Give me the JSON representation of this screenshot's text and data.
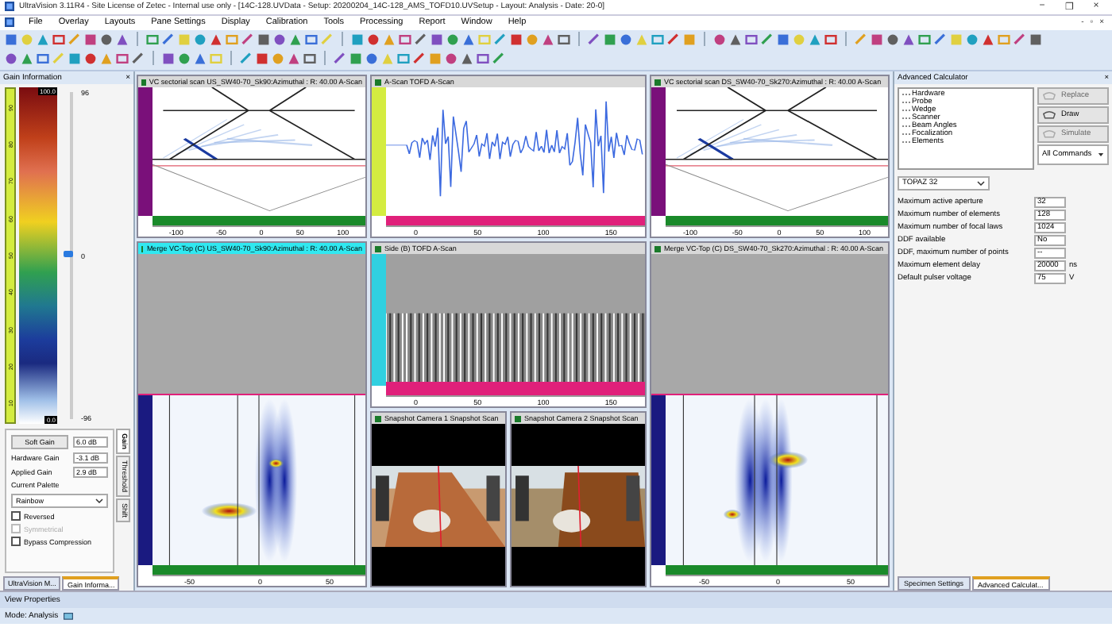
{
  "window": {
    "title": "UltraVision 3.11R4 - Site License of Zetec - Internal use only - [14C-128.UVData - Setup: 20200204_14C-128_AMS_TOFD10.UVSetup - Layout: Analysis - Date: 20-0]",
    "controls": [
      "−",
      "❐",
      "×"
    ],
    "mdi_controls": [
      "-",
      "▫",
      "×"
    ]
  },
  "menu": [
    "File",
    "Overlay",
    "Layouts",
    "Pane Settings",
    "Display",
    "Calibration",
    "Tools",
    "Processing",
    "Report",
    "Window",
    "Help"
  ],
  "gain_panel": {
    "title": "Gain Information",
    "close": "×",
    "palette_max": "100.0",
    "palette_min": "0.0",
    "palette_ticks": [
      "90",
      "80",
      "70",
      "60",
      "50",
      "40",
      "30",
      "20",
      "10"
    ],
    "slider": {
      "max": "96",
      "mid": "0",
      "min": "-96",
      "level": 0.5
    },
    "gains": [
      {
        "kind": "button",
        "label": "Soft Gain",
        "value": "6.0 dB"
      },
      {
        "kind": "text",
        "label": "Hardware Gain",
        "value": "-3.1 dB"
      },
      {
        "kind": "text",
        "label": "Applied Gain",
        "value": "2.9 dB"
      }
    ],
    "palette_label": "Current Palette",
    "palette": "Rainbow",
    "options": [
      {
        "label": "Reversed",
        "checked": false,
        "disabled": false
      },
      {
        "label": "Symmetrical",
        "checked": false,
        "disabled": true
      },
      {
        "label": "Bypass Compression",
        "checked": false,
        "disabled": false
      }
    ],
    "side_tabs": [
      {
        "label": "Gain",
        "selected": true
      },
      {
        "label": "Threshold",
        "selected": false
      },
      {
        "label": "Shift",
        "selected": false
      }
    ],
    "bottom_tabs": [
      {
        "label": "UltraVision M...",
        "selected": false
      },
      {
        "label": "Gain Informa...",
        "selected": true
      }
    ]
  },
  "views": [
    {
      "title": "VC sectorial scan US_SW40-70_Sk90:Azimuthal : R: 40.00 A-Scan",
      "kind": "sector",
      "scale": [
        "-100",
        "-50",
        "0",
        "50",
        "100"
      ]
    },
    {
      "title": "A-Scan TOFD A-Scan",
      "kind": "ascan",
      "scale": [
        "0",
        "50",
        "100",
        "150"
      ]
    },
    {
      "title": "VC sectorial scan DS_SW40-70_Sk270:Azimuthal : R: 40.00 A-Scan",
      "kind": "sector",
      "scale": [
        "-100",
        "-50",
        "0",
        "50",
        "100"
      ]
    },
    {
      "title": "Merge VC-Top (C) US_SW40-70_Sk90:Azimuthal : R: 40.00 A-Scan",
      "kind": "cscan",
      "scale": [
        "-50",
        "0",
        "50"
      ]
    },
    {
      "title": "Side (B) TOFD A-Scan",
      "kind": "bscan",
      "scale": [
        "0",
        "50",
        "100",
        "150"
      ]
    },
    {
      "title": "Merge VC-Top (C) DS_SW40-70_Sk270:Azimuthal : R: 40.00 A-Scan",
      "kind": "cscan",
      "scale": [
        "-50",
        "0",
        "50"
      ]
    },
    {
      "title": "Snapshot Camera 1 Snapshot Scan",
      "kind": "camera"
    },
    {
      "title": "Snapshot Camera 2 Snapshot Scan",
      "kind": "camera"
    }
  ],
  "calculator": {
    "title": "Advanced Calculator",
    "close": "×",
    "tree": [
      "Hardware",
      "Probe",
      "Wedge",
      "Scanner",
      "Beam Angles",
      "Focalization",
      "Elements"
    ],
    "buttons": [
      {
        "label": "Replace",
        "disabled": true
      },
      {
        "label": "Draw",
        "disabled": false
      },
      {
        "label": "Simulate",
        "disabled": true
      }
    ],
    "commands": "All Commands",
    "device": "TOPAZ 32",
    "fields": [
      {
        "label": "Maximum active aperture",
        "value": "32"
      },
      {
        "label": "Maximum number of elements",
        "value": "128"
      },
      {
        "label": "Maximum number of focal laws",
        "value": "1024"
      },
      {
        "label": "DDF available",
        "value": "No"
      },
      {
        "label": "DDF, maximum number of points",
        "value": "--"
      },
      {
        "label": "Maximum element delay",
        "value": "20000",
        "unit": "ns"
      },
      {
        "label": "Default pulser voltage",
        "value": "75",
        "unit": "V"
      }
    ],
    "bottom_tabs": [
      {
        "label": "Specimen Settings",
        "selected": false
      },
      {
        "label": "Advanced Calculat...",
        "selected": true
      }
    ]
  },
  "view_properties": "View Properties",
  "status": "Mode: Analysis"
}
